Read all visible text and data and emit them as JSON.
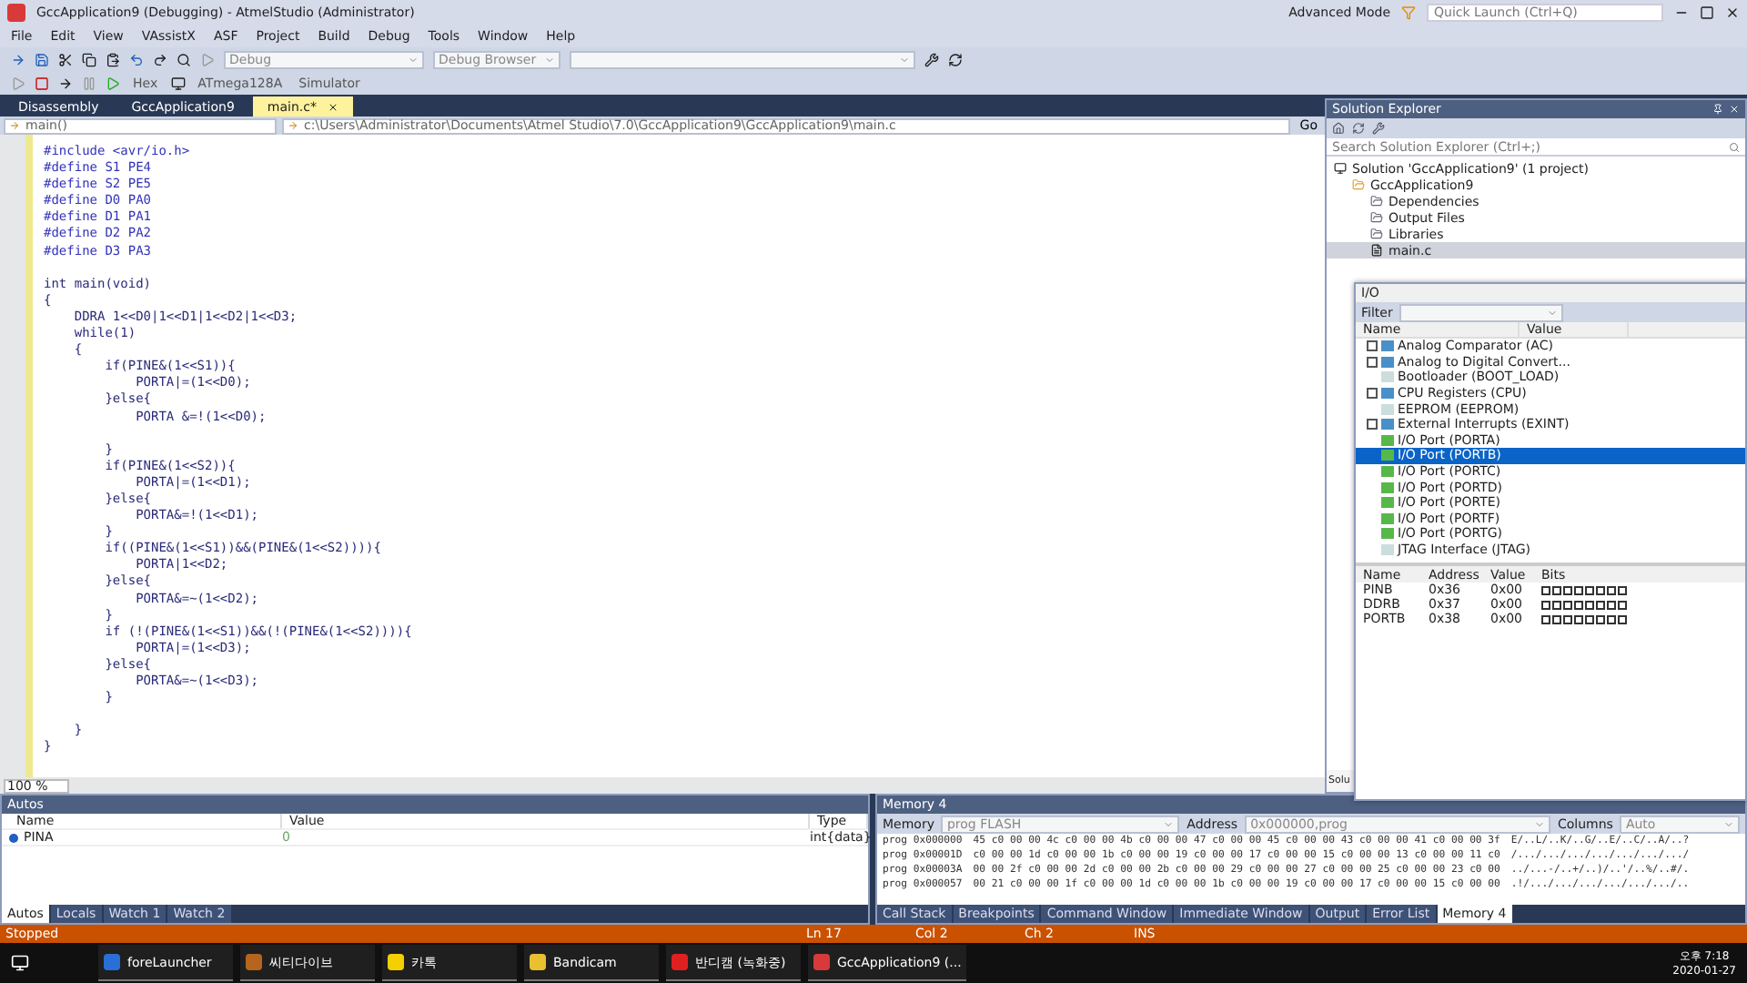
{
  "window": {
    "title": "GccApplication9 (Debugging) - AtmelStudio (Administrator)",
    "mode": "Advanced Mode",
    "quick_launch": {
      "placeholder": "Quick Launch (Ctrl+Q)"
    }
  },
  "menu": [
    "File",
    "Edit",
    "View",
    "VAssistX",
    "ASF",
    "Project",
    "Build",
    "Debug",
    "Tools",
    "Window",
    "Help"
  ],
  "toolbar": {
    "configuration": "Debug",
    "browser": "Debug Browser",
    "hex": "Hex",
    "device": "ATmega128A",
    "tool": "Simulator"
  },
  "doc_tabs": [
    {
      "label": "Disassembly",
      "selected": false
    },
    {
      "label": "GccApplication9",
      "selected": false
    },
    {
      "label": "main.c*",
      "selected": true
    }
  ],
  "nav": {
    "scope": "main()",
    "path": "c:\\Users\\Administrator\\Documents\\Atmel Studio\\7.0\\GccApplication9\\GccApplication9\\main.c",
    "go": "Go"
  },
  "code": [
    {
      "kind": "directive",
      "text": "#include <avr/io.h>"
    },
    {
      "kind": "directive",
      "text": "#define S1 PE4"
    },
    {
      "kind": "directive",
      "text": "#define S2 PE5"
    },
    {
      "kind": "directive",
      "text": "#define D0 PA0"
    },
    {
      "kind": "directive",
      "text": "#define D1 PA1"
    },
    {
      "kind": "directive",
      "text": "#define D2 PA2"
    },
    {
      "kind": "directive",
      "text": "#define D3 PA3"
    },
    {
      "kind": "blank"
    },
    {
      "kind": "code",
      "text": "int main(void)"
    },
    {
      "kind": "code",
      "text": "{"
    },
    {
      "kind": "code",
      "text": "    DDRA 1<<D0|1<<D1|1<<D2|1<<D3;"
    },
    {
      "kind": "code",
      "text": "    while(1)"
    },
    {
      "kind": "code",
      "text": "    {"
    },
    {
      "kind": "code",
      "text": "        if(PINE&(1<<S1)){"
    },
    {
      "kind": "code",
      "text": "            PORTA|=(1<<D0);"
    },
    {
      "kind": "code",
      "text": "        }else{"
    },
    {
      "kind": "code",
      "text": "            PORTA &=!(1<<D0);"
    },
    {
      "kind": "blank"
    },
    {
      "kind": "code",
      "text": "        }"
    },
    {
      "kind": "code",
      "text": "        if(PINE&(1<<S2)){"
    },
    {
      "kind": "code",
      "text": "            PORTA|=(1<<D1);"
    },
    {
      "kind": "code",
      "text": "        }else{"
    },
    {
      "kind": "code",
      "text": "            PORTA&=!(1<<D1);"
    },
    {
      "kind": "code",
      "text": "        }"
    },
    {
      "kind": "code",
      "text": "        if((PINE&(1<<S1))&&(PINE&(1<<S2)))){"
    },
    {
      "kind": "code",
      "text": "            PORTA|1<<D2;"
    },
    {
      "kind": "code",
      "text": "        }else{"
    },
    {
      "kind": "code",
      "text": "            PORTA&=~(1<<D2);"
    },
    {
      "kind": "code",
      "text": "        }"
    },
    {
      "kind": "code",
      "text": "        if (!(PINE&(1<<S1))&&(!(PINE&(1<<S2)))){"
    },
    {
      "kind": "code",
      "text": "            PORTA|=(1<<D3);"
    },
    {
      "kind": "code",
      "text": "        }else{"
    },
    {
      "kind": "code",
      "text": "            PORTA&=~(1<<D3);"
    },
    {
      "kind": "code",
      "text": "        }"
    },
    {
      "kind": "blank"
    },
    {
      "kind": "code",
      "text": "    }"
    },
    {
      "kind": "code",
      "text": "}"
    }
  ],
  "zoom": "100 %",
  "solution_explorer": {
    "title": "Solution Explorer",
    "search": {
      "placeholder": "Search Solution Explorer (Ctrl+;)"
    },
    "items": [
      {
        "label": "Solution 'GccApplication9' (1 project)",
        "kind": "solution",
        "selected": false,
        "children": [
          {
            "label": "GccApplication9",
            "kind": "project",
            "selected": false,
            "children": [
              {
                "label": "Dependencies",
                "kind": "folder",
                "selected": false
              },
              {
                "label": "Output Files",
                "kind": "folder",
                "selected": false
              },
              {
                "label": "Libraries",
                "kind": "folder",
                "selected": false
              },
              {
                "label": "main.c",
                "kind": "file",
                "selected": true
              }
            ]
          }
        ]
      }
    ],
    "footer": "Solu"
  },
  "io": {
    "title": "I/O",
    "filter": "Filter",
    "columns": [
      "Name",
      "Value"
    ],
    "items": [
      {
        "label": "Analog Comparator (AC)",
        "kind": "group",
        "selected": false
      },
      {
        "label": "Analog to Digital Convert...",
        "kind": "group",
        "selected": false
      },
      {
        "label": "Bootloader (BOOT_LOAD)",
        "kind": "leaf",
        "selected": false
      },
      {
        "label": "CPU Registers (CPU)",
        "kind": "group",
        "selected": false
      },
      {
        "label": "EEPROM (EEPROM)",
        "kind": "leaf",
        "selected": false
      },
      {
        "label": "External Interrupts (EXINT)",
        "kind": "group",
        "selected": false
      },
      {
        "label": "I/O Port (PORTA)",
        "kind": "port",
        "selected": false
      },
      {
        "label": "I/O Port (PORTB)",
        "kind": "port",
        "selected": true
      },
      {
        "label": "I/O Port (PORTC)",
        "kind": "port",
        "selected": false
      },
      {
        "label": "I/O Port (PORTD)",
        "kind": "port",
        "selected": false
      },
      {
        "label": "I/O Port (PORTE)",
        "kind": "port",
        "selected": false
      },
      {
        "label": "I/O Port (PORTF)",
        "kind": "port",
        "selected": false
      },
      {
        "label": "I/O Port (PORTG)",
        "kind": "port",
        "selected": false
      },
      {
        "label": "JTAG Interface (JTAG)",
        "kind": "leaf",
        "selected": false
      }
    ],
    "register_columns": [
      "Name",
      "Address",
      "Value",
      "Bits"
    ],
    "registers": [
      {
        "name": "PINB",
        "address": "0x36",
        "value": "0x00"
      },
      {
        "name": "DDRB",
        "address": "0x37",
        "value": "0x00"
      },
      {
        "name": "PORTB",
        "address": "0x38",
        "value": "0x00"
      }
    ]
  },
  "autos": {
    "title": "Autos",
    "columns": [
      "Name",
      "Value",
      "Type"
    ],
    "rows": [
      {
        "name": "PINA",
        "value": "0",
        "type": "int{data}"
      }
    ],
    "tabs": [
      {
        "label": "Autos",
        "selected": true
      },
      {
        "label": "Locals",
        "selected": false
      },
      {
        "label": "Watch 1",
        "selected": false
      },
      {
        "label": "Watch 2",
        "selected": false
      }
    ]
  },
  "memory": {
    "title": "Memory 4",
    "memory_label": "Memory",
    "memory_value": "prog FLASH",
    "address_label": "Address",
    "address_value": "0x000000,prog",
    "columns_label": "Columns",
    "columns_value": "Auto",
    "rows": [
      {
        "address": "prog 0x000000",
        "bytes": "45 c0 00 00 4c c0 00 00 4b c0 00 00 47 c0 00 00 45 c0 00 00 43 c0 00 00 41 c0 00 00 3f",
        "ascii": "E/..L/..K/..G/..E/..C/..A/..?"
      },
      {
        "address": "prog 0x00001D",
        "bytes": "c0 00 00 1d c0 00 00 1b c0 00 00 19 c0 00 00 17 c0 00 00 15 c0 00 00 13 c0 00 00 11 c0",
        "ascii": "/.../.../.../.../.../.../.../"
      },
      {
        "address": "prog 0x00003A",
        "bytes": "00 00 2f c0 00 00 2d c0 00 00 2b c0 00 00 29 c0 00 00 27 c0 00 00 25 c0 00 00 23 c0 00",
        "ascii": "../...-/..+/..)/..'/..%/..#/."
      },
      {
        "address": "prog 0x000057",
        "bytes": "00 21 c0 00 00 1f c0 00 00 1d c0 00 00 1b c0 00 00 19 c0 00 00 17 c0 00 00 15 c0 00 00",
        "ascii": ".!/.../.../.../.../.../.../.."
      }
    ],
    "tabs": [
      {
        "label": "Call Stack",
        "selected": false
      },
      {
        "label": "Breakpoints",
        "selected": false
      },
      {
        "label": "Command Window",
        "selected": false
      },
      {
        "label": "Immediate Window",
        "selected": false
      },
      {
        "label": "Output",
        "selected": false
      },
      {
        "label": "Error List",
        "selected": false
      },
      {
        "label": "Memory 4",
        "selected": true
      }
    ]
  },
  "status_bar": {
    "state": "Stopped",
    "line": "Ln 17",
    "col": "Col 2",
    "ch": "Ch 2",
    "mode": "INS"
  },
  "taskbar": {
    "apps": [
      {
        "label": "foreLauncher",
        "color": "#2a6fd6"
      },
      {
        "label": "씨티다이브",
        "color": "#b5651d"
      },
      {
        "label": "카톡",
        "color": "#f5d000"
      },
      {
        "label": "Bandicam",
        "color": "#e8c030"
      },
      {
        "label": "반디캠 (녹화중)",
        "color": "#e02020"
      },
      {
        "label": "GccApplication9 (...",
        "color": "#d83a3a"
      }
    ],
    "time": "오후 7:18",
    "date": "2020-01-27"
  }
}
